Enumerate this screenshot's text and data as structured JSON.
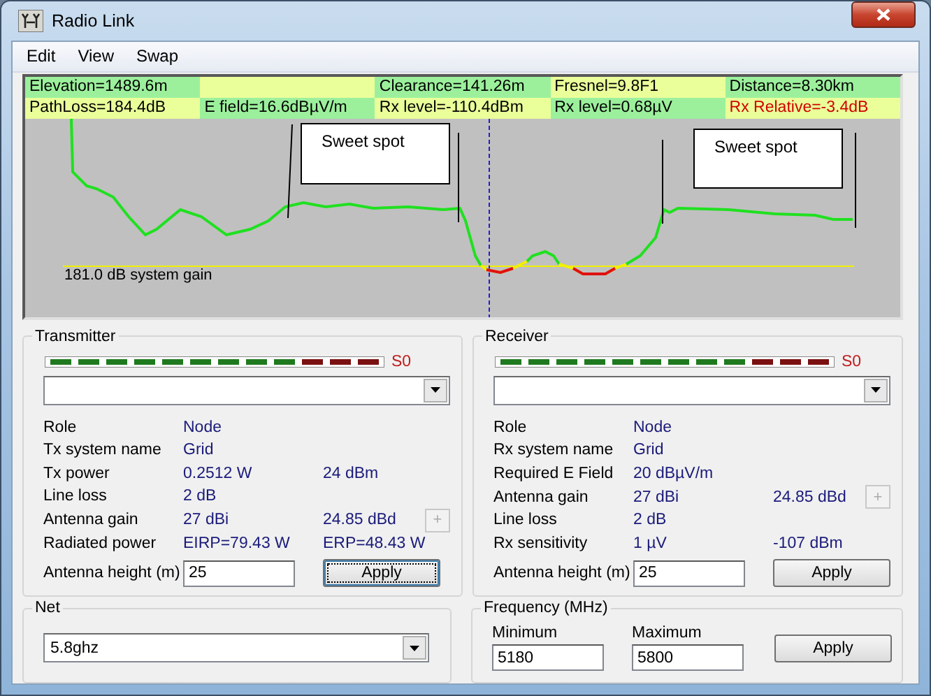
{
  "window": {
    "title": "Radio Link"
  },
  "menu": [
    {
      "label": "Edit"
    },
    {
      "label": "View"
    },
    {
      "label": "Swap"
    }
  ],
  "info": [
    {
      "top": {
        "text": "Elevation=1489.6m",
        "alert": false
      },
      "bottom": {
        "text": "PathLoss=184.4dB",
        "alert": false
      }
    },
    {
      "bottom": {
        "text": "E field=16.6dBµV/m",
        "alert": false
      }
    },
    {
      "top": {
        "text": "Clearance=141.26m",
        "alert": false
      },
      "bottom": {
        "text": "Rx level=-110.4dBm",
        "alert": false
      }
    },
    {
      "top": {
        "text": "Fresnel=9.8F1",
        "alert": false
      },
      "bottom": {
        "text": "Rx level=0.68µV",
        "alert": false
      }
    },
    {
      "top": {
        "text": "Distance=8.30km",
        "alert": false
      },
      "bottom": {
        "text": "Rx Relative=-3.4dB",
        "alert": true
      }
    }
  ],
  "profile": {
    "gain_label": "181.0 dB system gain",
    "notes": [
      {
        "text": "Sweet spot"
      },
      {
        "text": "Sweet spot"
      }
    ]
  },
  "transmitter": {
    "title": "Transmitter",
    "meter_label": "S0",
    "rows": [
      {
        "label": "Role",
        "value": "Node"
      },
      {
        "label": "Tx system name",
        "value": "Grid"
      },
      {
        "label": "Tx power",
        "value": "0.2512 W",
        "value_2": "24 dBm"
      },
      {
        "label": "Line loss",
        "value": "2 dB"
      },
      {
        "label": "Antenna gain",
        "value": "27 dBi",
        "value_2": "24.85 dBd",
        "button": "+"
      },
      {
        "label": "Radiated power",
        "value": "EIRP=79.43 W",
        "value_2": "ERP=48.43 W"
      }
    ],
    "height": {
      "label": "Antenna height (m)",
      "value": "25"
    },
    "apply": {
      "label": "Apply",
      "focused": true
    }
  },
  "receiver": {
    "title": "Receiver",
    "meter_label": "S0",
    "rows": [
      {
        "label": "Role",
        "value": "Node"
      },
      {
        "label": "Rx system name",
        "value": "Grid"
      },
      {
        "label": "Required E Field",
        "value": "20 dBµV/m"
      },
      {
        "label": "Antenna gain",
        "value": "27 dBi",
        "value_2": "24.85 dBd",
        "button": "+"
      },
      {
        "label": "Line loss",
        "value": "2 dB"
      },
      {
        "label": "Rx sensitivity",
        "value": "1 µV",
        "value_2": "-107 dBm"
      }
    ],
    "height": {
      "label": "Antenna height (m)",
      "value": "25"
    },
    "apply": {
      "label": "Apply",
      "focused": false
    }
  },
  "net": {
    "title": "Net",
    "value": "5.8ghz"
  },
  "frequency": {
    "title": "Frequency (MHz)",
    "minimum": {
      "label": "Minimum",
      "value": "5180"
    },
    "maximum": {
      "label": "Maximum",
      "value": "5800"
    },
    "apply": {
      "label": "Apply"
    }
  }
}
